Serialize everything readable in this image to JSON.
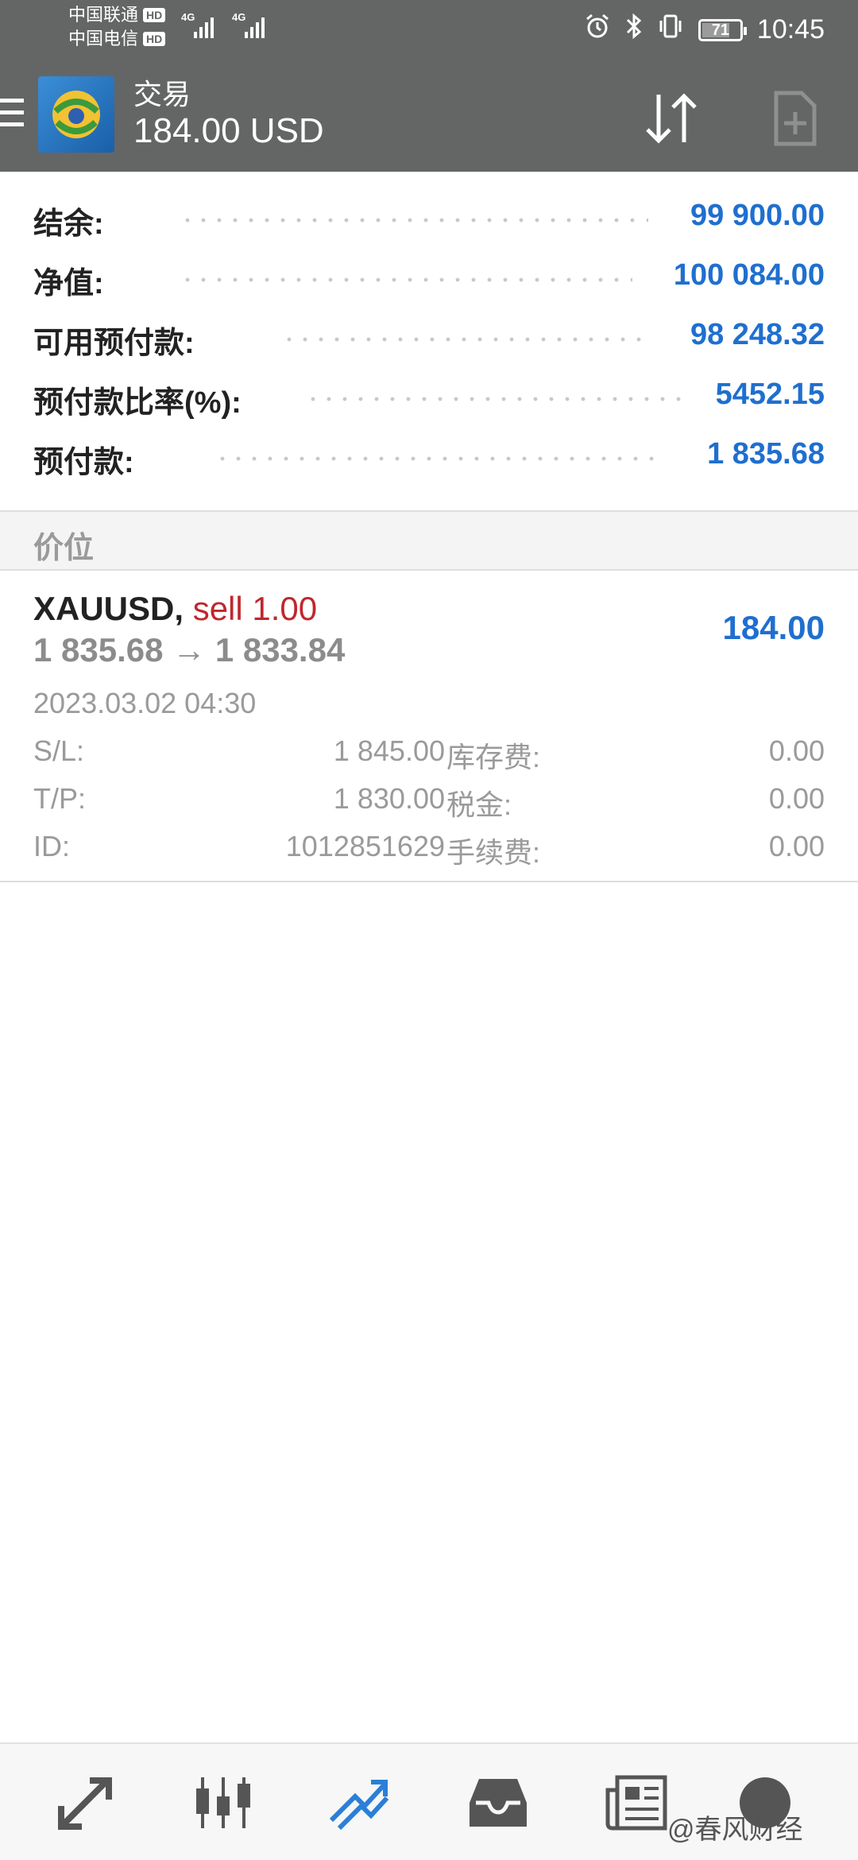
{
  "status_bar": {
    "carrier1": "中国联通",
    "carrier2": "中国电信",
    "hd_label": "HD",
    "network_label": "4G",
    "battery": "71",
    "time": "10:45"
  },
  "header": {
    "title": "交易",
    "balance_line": "184.00 USD"
  },
  "summary": [
    {
      "label": "结余:",
      "value": "99 900.00"
    },
    {
      "label": "净值:",
      "value": "100 084.00"
    },
    {
      "label": "可用预付款:",
      "value": "98 248.32"
    },
    {
      "label": "预付款比率(%):",
      "value": "5452.15"
    },
    {
      "label": "预付款:",
      "value": "1 835.68"
    }
  ],
  "section_title": "价位",
  "position": {
    "symbol": "XAUUSD,",
    "side": "sell 1.00",
    "prices": "1 835.68 → 1 833.84",
    "profit": "184.00",
    "open_time": "2023.03.02 04:30",
    "details": [
      {
        "label": "S/L:",
        "value": "1 845.00",
        "label2": "库存费:",
        "value2": "0.00"
      },
      {
        "label": "T/P:",
        "value": "1 830.00",
        "label2": "税金:",
        "value2": "0.00"
      },
      {
        "label": "ID:",
        "value": "1012851629",
        "label2": "手续费:",
        "value2": "0.00"
      }
    ]
  },
  "watermark": "@春风财经",
  "colors": {
    "header_bg": "#646665",
    "value_blue": "#1f6fcf",
    "sell_red": "#c0272d",
    "nav_active": "#2b7fd8"
  }
}
